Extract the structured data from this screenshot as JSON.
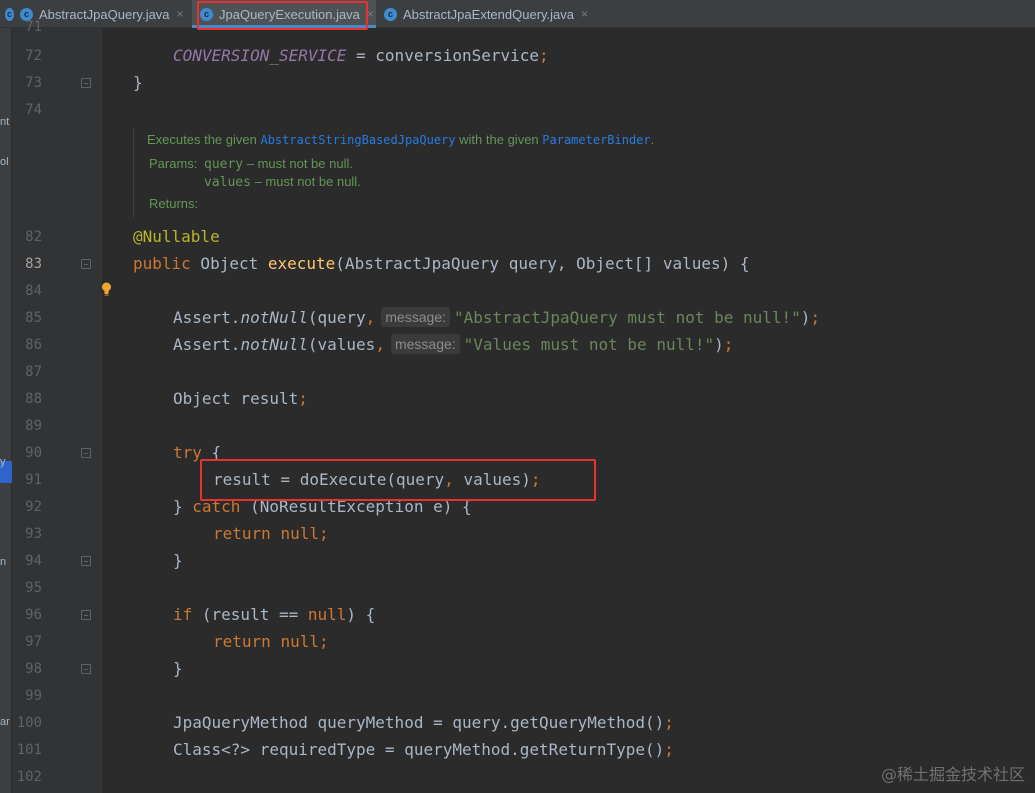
{
  "tabs": [
    {
      "name": "AbstractJpaQuery.java",
      "close": "×"
    },
    {
      "name": "JpaQueryExecution.java",
      "close": "×"
    },
    {
      "name": "AbstractJpaExtendQuery.java",
      "close": "×"
    }
  ],
  "tab_icon_letter": "c",
  "left_strip_labels": [
    "nt",
    "ol",
    "y",
    "n",
    "ar"
  ],
  "line_numbers": [
    "71",
    "72",
    "73",
    "74",
    "82",
    "83",
    "84",
    "85",
    "86",
    "87",
    "88",
    "89",
    "90",
    "91",
    "92",
    "93",
    "94",
    "95",
    "96",
    "97",
    "98",
    "99",
    "100",
    "101",
    "102"
  ],
  "code": {
    "l72_const": "CONVERSION_SERVICE",
    "l72_rest": " = conversionService",
    "semi": ";",
    "l73": "}",
    "l82": "@Nullable",
    "l83_kw": "public",
    "l83_type": " Object ",
    "l83_fn": "execute",
    "l83_rest": "(AbstractJpaQuery query, Object[] values) {",
    "l85_a": "Assert.",
    "l85_m": "notNull",
    "l85_b": "(query",
    "comma": ",",
    "hint": "message:",
    "l85_str": "\"AbstractJpaQuery must not be null!\"",
    "l85_end": ")",
    "l86_b": "(values",
    "l86_str": "\"Values must not be null!\"",
    "l88": "Object result",
    "l90_kw": "try",
    "l90_rest": " {",
    "l91_a": "result = doExecute(query",
    "l91_b": " values)",
    "l92_a": "} ",
    "l92_kw": "catch",
    "l92_b": " (NoResultException e) {",
    "return_kw": "return",
    "null_kw": "null",
    "l94": "}",
    "l96_kw": "if",
    "l96_a": " (result == ",
    "l96_b": ") {",
    "l98": "}",
    "l100": "JpaQueryMethod queryMethod = query.getQueryMethod()",
    "l101": "Class<?> requiredType = queryMethod.getReturnType()"
  },
  "doc": {
    "line1_a": "Executes the given ",
    "line1_link1": "AbstractStringBasedJpaQuery",
    "line1_b": " with the given ",
    "line1_link2": "ParameterBinder",
    "line1_c": ".",
    "params_label": "Params:",
    "p1_name": "query",
    "p1_desc": " – must not be null.",
    "p2_name": "values",
    "p2_desc": " – must not be null.",
    "returns_label": "Returns:"
  },
  "watermark": "@稀土掘金技术社区",
  "colors": {
    "highlight_box": "#e5342f",
    "active_tab_underline": "#4a88c7"
  }
}
